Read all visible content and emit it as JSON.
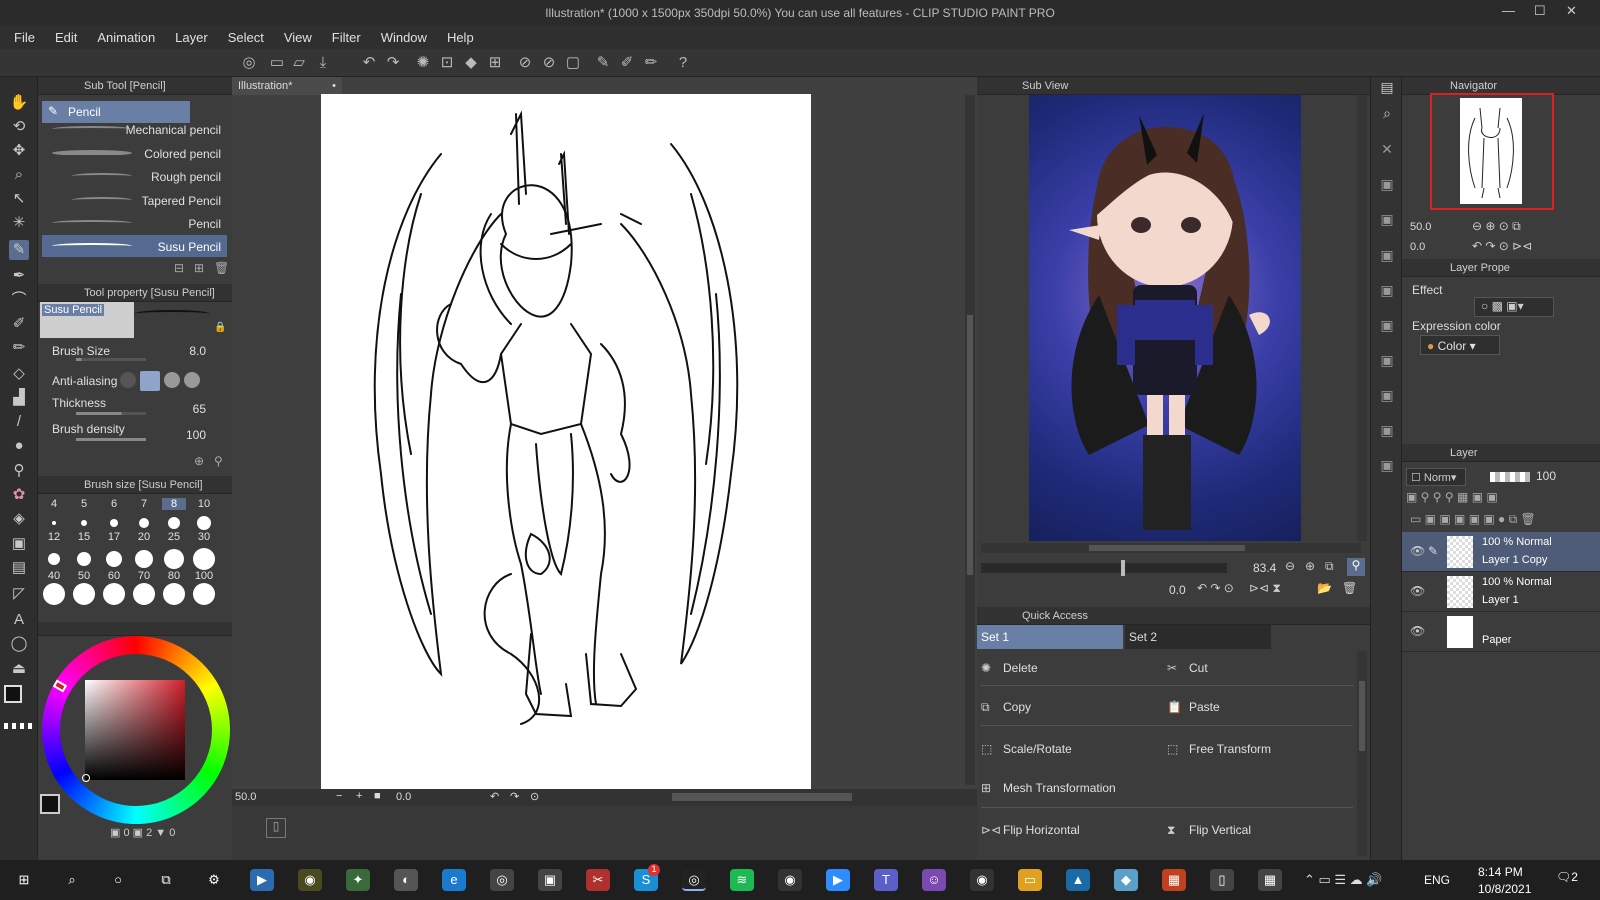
{
  "window": {
    "title": "Illustration* (1000 x 1500px 350dpi 50.0%)  You can use all features - CLIP STUDIO PAINT PRO"
  },
  "menu": [
    "File",
    "Edit",
    "Animation",
    "Layer",
    "Select",
    "View",
    "Filter",
    "Window",
    "Help"
  ],
  "subtool": {
    "header": "Sub Tool [Pencil]",
    "group": "Pencil",
    "items": [
      "Mechanical pencil",
      "Colored pencil",
      "Rough pencil",
      "Tapered Pencil",
      "Pencil",
      "Susu Pencil"
    ],
    "active_index": 5
  },
  "toolprop": {
    "header": "Tool property [Susu Pencil]",
    "preview_label": "Susu Pencil",
    "brush_size_label": "Brush Size",
    "brush_size_value": "8.0",
    "antialias_label": "Anti-aliasing",
    "thickness_label": "Thickness",
    "thickness_value": "65",
    "density_label": "Brush density",
    "density_value": "100"
  },
  "brushsize": {
    "header": "Brush size [Susu Pencil]",
    "row1": [
      "4",
      "5",
      "6",
      "7",
      "8",
      "10"
    ],
    "row2": [
      "12",
      "15",
      "17",
      "20",
      "25",
      "30"
    ],
    "row3": [
      "40",
      "50",
      "60",
      "70",
      "80",
      "100"
    ],
    "selected": "8"
  },
  "color": {
    "main": "#111111",
    "sub": "#ffffff",
    "saturation_hue": "#d21f2a",
    "footer_a": "0",
    "footer_b": "2",
    "footer_c": "0"
  },
  "canvas": {
    "tab": "Illustration*",
    "zoom": "50.0",
    "rotation": "0.0"
  },
  "subview": {
    "header": "Sub View",
    "zoom": "83.4",
    "rotation": "0.0"
  },
  "quickaccess": {
    "header": "Quick Access",
    "tabs": [
      "Set 1",
      "Set 2"
    ],
    "items": [
      {
        "label": "Delete",
        "icon": "delete-icon"
      },
      {
        "label": "Cut",
        "icon": "scissors-icon"
      },
      {
        "label": "Copy",
        "icon": "copy-icon"
      },
      {
        "label": "Paste",
        "icon": "paste-icon"
      },
      {
        "label": "Scale/Rotate",
        "icon": "scale-rotate-icon"
      },
      {
        "label": "Free Transform",
        "icon": "free-transform-icon"
      },
      {
        "label": "Mesh Transformation",
        "icon": "mesh-icon"
      },
      {
        "label": "Flip Horizontal",
        "icon": "flip-horizontal-icon"
      },
      {
        "label": "Flip Vertical",
        "icon": "flip-vertical-icon"
      }
    ]
  },
  "navigator": {
    "header": "Navigator",
    "zoom": "50.0",
    "rotation": "0.0"
  },
  "layerprop": {
    "header": "Layer Prope",
    "effect_label": "Effect",
    "expression_label": "Expression color",
    "expression_value": "Color"
  },
  "layers": {
    "header": "Layer",
    "blend": "Norm",
    "opacity": "100",
    "rows": [
      {
        "mode": "100 % Normal",
        "name": "Layer 1 Copy"
      },
      {
        "mode": "100 % Normal",
        "name": "Layer 1"
      },
      {
        "mode": "",
        "name": "Paper"
      }
    ]
  },
  "taskbar": {
    "lang": "ENG",
    "time": "8:14 PM",
    "date": "10/8/2021",
    "notifications": "2",
    "badge": "1"
  }
}
